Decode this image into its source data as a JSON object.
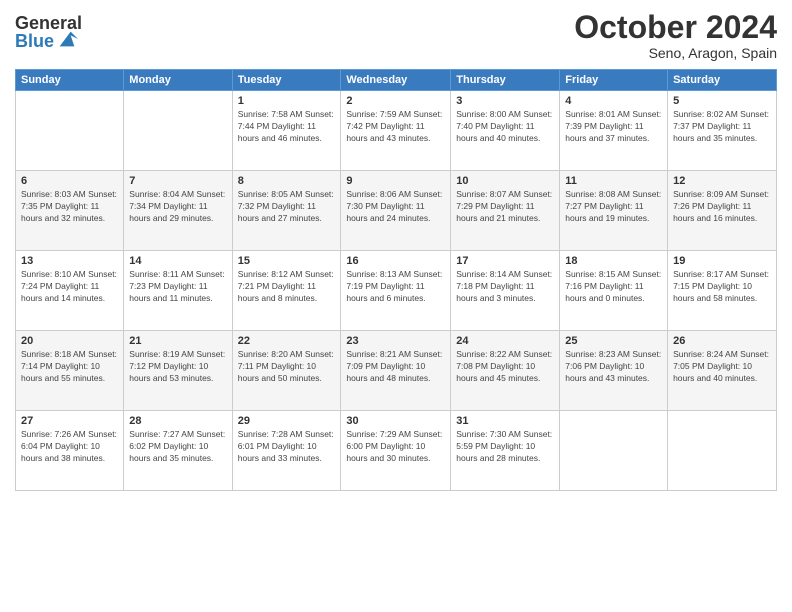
{
  "header": {
    "logo_general": "General",
    "logo_blue": "Blue",
    "month_title": "October 2024",
    "location": "Seno, Aragon, Spain"
  },
  "weekdays": [
    "Sunday",
    "Monday",
    "Tuesday",
    "Wednesday",
    "Thursday",
    "Friday",
    "Saturday"
  ],
  "weeks": [
    [
      {
        "day": "",
        "info": ""
      },
      {
        "day": "",
        "info": ""
      },
      {
        "day": "1",
        "info": "Sunrise: 7:58 AM\nSunset: 7:44 PM\nDaylight: 11 hours and 46 minutes."
      },
      {
        "day": "2",
        "info": "Sunrise: 7:59 AM\nSunset: 7:42 PM\nDaylight: 11 hours and 43 minutes."
      },
      {
        "day": "3",
        "info": "Sunrise: 8:00 AM\nSunset: 7:40 PM\nDaylight: 11 hours and 40 minutes."
      },
      {
        "day": "4",
        "info": "Sunrise: 8:01 AM\nSunset: 7:39 PM\nDaylight: 11 hours and 37 minutes."
      },
      {
        "day": "5",
        "info": "Sunrise: 8:02 AM\nSunset: 7:37 PM\nDaylight: 11 hours and 35 minutes."
      }
    ],
    [
      {
        "day": "6",
        "info": "Sunrise: 8:03 AM\nSunset: 7:35 PM\nDaylight: 11 hours and 32 minutes."
      },
      {
        "day": "7",
        "info": "Sunrise: 8:04 AM\nSunset: 7:34 PM\nDaylight: 11 hours and 29 minutes."
      },
      {
        "day": "8",
        "info": "Sunrise: 8:05 AM\nSunset: 7:32 PM\nDaylight: 11 hours and 27 minutes."
      },
      {
        "day": "9",
        "info": "Sunrise: 8:06 AM\nSunset: 7:30 PM\nDaylight: 11 hours and 24 minutes."
      },
      {
        "day": "10",
        "info": "Sunrise: 8:07 AM\nSunset: 7:29 PM\nDaylight: 11 hours and 21 minutes."
      },
      {
        "day": "11",
        "info": "Sunrise: 8:08 AM\nSunset: 7:27 PM\nDaylight: 11 hours and 19 minutes."
      },
      {
        "day": "12",
        "info": "Sunrise: 8:09 AM\nSunset: 7:26 PM\nDaylight: 11 hours and 16 minutes."
      }
    ],
    [
      {
        "day": "13",
        "info": "Sunrise: 8:10 AM\nSunset: 7:24 PM\nDaylight: 11 hours and 14 minutes."
      },
      {
        "day": "14",
        "info": "Sunrise: 8:11 AM\nSunset: 7:23 PM\nDaylight: 11 hours and 11 minutes."
      },
      {
        "day": "15",
        "info": "Sunrise: 8:12 AM\nSunset: 7:21 PM\nDaylight: 11 hours and 8 minutes."
      },
      {
        "day": "16",
        "info": "Sunrise: 8:13 AM\nSunset: 7:19 PM\nDaylight: 11 hours and 6 minutes."
      },
      {
        "day": "17",
        "info": "Sunrise: 8:14 AM\nSunset: 7:18 PM\nDaylight: 11 hours and 3 minutes."
      },
      {
        "day": "18",
        "info": "Sunrise: 8:15 AM\nSunset: 7:16 PM\nDaylight: 11 hours and 0 minutes."
      },
      {
        "day": "19",
        "info": "Sunrise: 8:17 AM\nSunset: 7:15 PM\nDaylight: 10 hours and 58 minutes."
      }
    ],
    [
      {
        "day": "20",
        "info": "Sunrise: 8:18 AM\nSunset: 7:14 PM\nDaylight: 10 hours and 55 minutes."
      },
      {
        "day": "21",
        "info": "Sunrise: 8:19 AM\nSunset: 7:12 PM\nDaylight: 10 hours and 53 minutes."
      },
      {
        "day": "22",
        "info": "Sunrise: 8:20 AM\nSunset: 7:11 PM\nDaylight: 10 hours and 50 minutes."
      },
      {
        "day": "23",
        "info": "Sunrise: 8:21 AM\nSunset: 7:09 PM\nDaylight: 10 hours and 48 minutes."
      },
      {
        "day": "24",
        "info": "Sunrise: 8:22 AM\nSunset: 7:08 PM\nDaylight: 10 hours and 45 minutes."
      },
      {
        "day": "25",
        "info": "Sunrise: 8:23 AM\nSunset: 7:06 PM\nDaylight: 10 hours and 43 minutes."
      },
      {
        "day": "26",
        "info": "Sunrise: 8:24 AM\nSunset: 7:05 PM\nDaylight: 10 hours and 40 minutes."
      }
    ],
    [
      {
        "day": "27",
        "info": "Sunrise: 7:26 AM\nSunset: 6:04 PM\nDaylight: 10 hours and 38 minutes."
      },
      {
        "day": "28",
        "info": "Sunrise: 7:27 AM\nSunset: 6:02 PM\nDaylight: 10 hours and 35 minutes."
      },
      {
        "day": "29",
        "info": "Sunrise: 7:28 AM\nSunset: 6:01 PM\nDaylight: 10 hours and 33 minutes."
      },
      {
        "day": "30",
        "info": "Sunrise: 7:29 AM\nSunset: 6:00 PM\nDaylight: 10 hours and 30 minutes."
      },
      {
        "day": "31",
        "info": "Sunrise: 7:30 AM\nSunset: 5:59 PM\nDaylight: 10 hours and 28 minutes."
      },
      {
        "day": "",
        "info": ""
      },
      {
        "day": "",
        "info": ""
      }
    ]
  ]
}
